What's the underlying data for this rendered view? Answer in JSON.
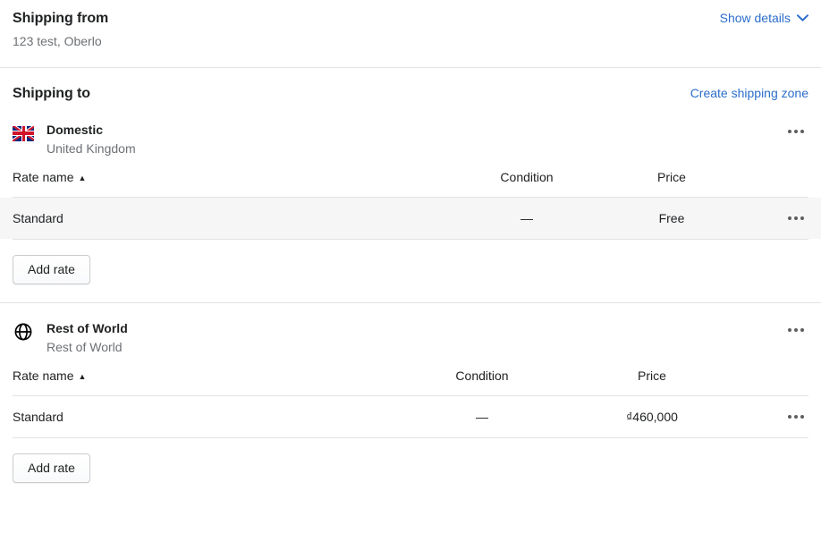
{
  "shipping_from": {
    "title": "Shipping from",
    "address": "123 test, Oberlo",
    "show_details_label": "Show details",
    "chevron_icon": "chevron-down-icon"
  },
  "shipping_to": {
    "title": "Shipping to",
    "create_zone_label": "Create shipping zone"
  },
  "colors": {
    "link": "#2c6ecb",
    "text": "#202223",
    "muted": "#6d7175",
    "border": "#e1e3e5",
    "row_hover": "#f6f6f7"
  },
  "zones": [
    {
      "name": "Domestic",
      "region": "United Kingdom",
      "icon": "uk-flag-icon",
      "overflow_icon": "more-options-icon",
      "columns": {
        "rate_name": "Rate name",
        "sort_indicator": "▲",
        "condition": "Condition",
        "price": "Price"
      },
      "rates": [
        {
          "name": "Standard",
          "condition": "—",
          "price": "Free",
          "overflow_icon": "more-options-icon",
          "highlighted": true
        }
      ],
      "add_rate_label": "Add rate"
    },
    {
      "name": "Rest of World",
      "region": "Rest of World",
      "icon": "globe-icon",
      "overflow_icon": "more-options-icon",
      "columns": {
        "rate_name": "Rate name",
        "sort_indicator": "▲",
        "condition": "Condition",
        "price": "Price"
      },
      "rates": [
        {
          "name": "Standard",
          "condition": "—",
          "price": "₫460,000",
          "overflow_icon": "more-options-icon",
          "highlighted": false
        }
      ],
      "add_rate_label": "Add rate"
    }
  ]
}
